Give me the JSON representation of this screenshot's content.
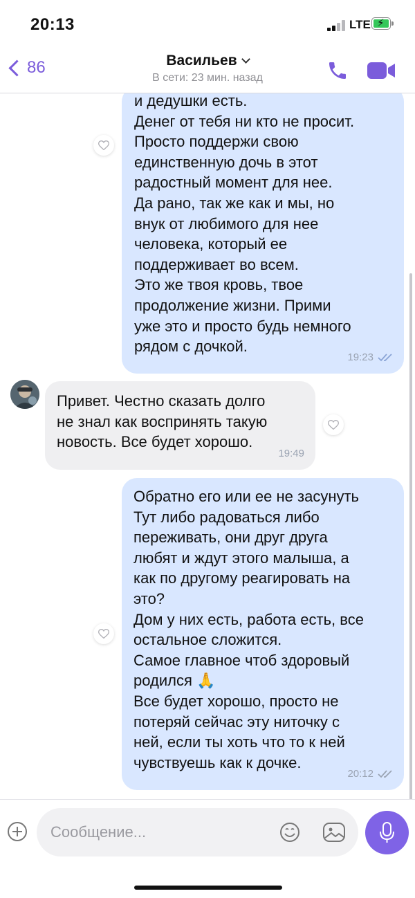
{
  "status_bar": {
    "time": "20:13",
    "network": "LTE"
  },
  "header": {
    "back_count": "86",
    "contact_name": "Васильев",
    "contact_status": "В сети: 23 мин. назад"
  },
  "messages": [
    {
      "direction": "out",
      "text": "и дедушки есть.\nДенег от тебя ни кто не просит.\nПросто поддержи свою\nединственную дочь в этот\nрадостный момент для нее.\nДа рано, так же как и мы, но\nвнук от любимого для нее\nчеловека, который ее\nподдерживает во всем.\nЭто же твоя кровь, твое\nпродолжение жизни. Прими\nуже это и просто будь немного\nрядом с дочкой.",
      "time": "19:23"
    },
    {
      "direction": "in",
      "text": "Привет. Честно сказать долго\nне знал как воспринять такую\nновость. Все будет хорошо.",
      "time": "19:49"
    },
    {
      "direction": "out",
      "text": "Обратно его или ее не засунуть\nТут либо радоваться либо\nпереживать, они друг друга\nлюбят и ждут этого малыша, а\nкак по другому реагировать на\nэто?\nДом у них есть, работа есть, все\nостальное сложится.\nСамое главное чтоб здоровый\nродился 🙏\nВсе будет хорошо, просто не\nпотеряй сейчас эту ниточку с\nней, если ты хоть что то к ней\nчувствуешь как к дочке.",
      "time": "20:12"
    }
  ],
  "composer": {
    "placeholder": "Сообщение..."
  },
  "colors": {
    "accent": "#7b5cdb",
    "outgoing_bubble": "#d9e7ff",
    "incoming_bubble": "#efeff1"
  }
}
